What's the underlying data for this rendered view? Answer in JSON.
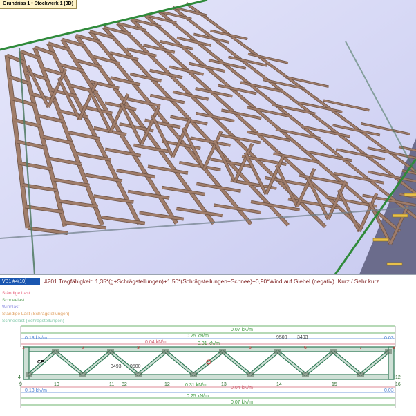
{
  "viewport": {
    "tab_label": "Grundriss 1 • Stockwerk 1 (3D)"
  },
  "pane": {
    "label": "VB1 #4(10)",
    "title": "#201 Tragfähigkeit: 1,35*(g+Schrägstellungen)+1,50*(Schrägstellungen+Schnee)+0,90*Wind auf Giebel (negativ). Kurz / Sehr kurz"
  },
  "legend": [
    {
      "text": "Ständige Last",
      "color": "#e8647e"
    },
    {
      "text": "Schneelast",
      "color": "#6aa96a"
    },
    {
      "text": "Windlast",
      "color": "#8a8ae0"
    },
    {
      "text": "Ständige Last (Schrägstellungen)",
      "color": "#e0a060"
    },
    {
      "text": "Schneelast (Schrägstellungen)",
      "color": "#7fc8a8"
    }
  ],
  "colors": {
    "timber": "#a07d6a",
    "timber_dark": "#6e5548",
    "floor": "#d7d9f6",
    "truss_member": "#2f7a56",
    "top_load": "#4b7fd2",
    "pink_load": "#d06070",
    "green_load": "#3e9a3e"
  },
  "loads": {
    "top_1": "0.13 kN/m",
    "top_2": "0.07 kN/m",
    "top_3": "0.25 kN/m",
    "top_end": "0.03",
    "mid_1": "0.04 kN/m",
    "mid_2": "0.31 kN/m",
    "bottom_1": "0.31 kN/m",
    "bottom_2": "0.04 kN/m",
    "bottom_3": "0.13 kN/m",
    "bottom_4": "0.25 kN/m",
    "bottom_5": "0.07 kN/m",
    "bottom_end": "0.03"
  },
  "dimensions": {
    "d1": "9500",
    "d2": "3493",
    "d3": "3493",
    "d4": "9500"
  },
  "nodes": {
    "top": [
      "1",
      "2",
      "3",
      "5",
      "6",
      "7",
      "8"
    ],
    "bottom": [
      "9",
      "10",
      "11",
      "12",
      "13",
      "14",
      "15",
      "16"
    ],
    "side": [
      "4",
      "12"
    ],
    "extra": [
      "82"
    ]
  },
  "badges": {
    "ce_mark": "CE"
  }
}
